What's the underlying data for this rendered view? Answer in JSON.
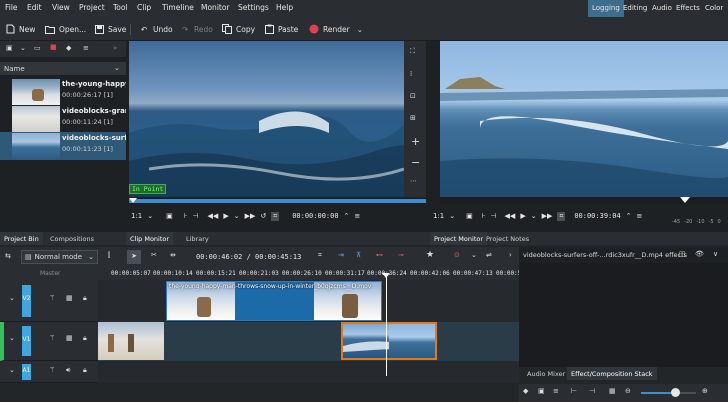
{
  "menu": [
    "File",
    "Edit",
    "View",
    "Project",
    "Tool",
    "Clip",
    "Timeline",
    "Monitor",
    "Settings",
    "Help"
  ],
  "layouts": [
    {
      "label": "Logging",
      "active": true
    },
    {
      "label": "Editing",
      "active": false
    },
    {
      "label": "Audio",
      "active": false
    },
    {
      "label": "Effects",
      "active": false
    },
    {
      "label": "Color",
      "active": false
    }
  ],
  "toolbar": {
    "new": "New",
    "open": "Open...",
    "save": "Save",
    "undo": "Undo",
    "redo": "Redo",
    "copy": "Copy",
    "paste": "Paste",
    "render": "Render"
  },
  "bin": {
    "column_header": "Name",
    "clips": [
      {
        "name": "the-young-happy-",
        "duration": "00:00:26:17 [1]",
        "selected": false
      },
      {
        "name": "videoblocks-grand",
        "duration": "00:00:11:24 [1]",
        "selected": false
      },
      {
        "name": "videoblocks-surfer",
        "duration": "00:00:11:23 [1]",
        "selected": true
      }
    ]
  },
  "left_tabs": [
    "Project Bin",
    "Compositions"
  ],
  "clip_monitor": {
    "overlay": "In Point",
    "zoom": "1:1",
    "timecode": "00:00:00:00",
    "tabs": [
      "Clip Monitor",
      "Library"
    ]
  },
  "project_monitor": {
    "zoom": "1:1",
    "timecode": "00:00:39:04",
    "tabs": [
      "Project Monitor",
      "Project Notes"
    ],
    "audio_scale": [
      "-45",
      "-20",
      "-10",
      "-5",
      "0"
    ]
  },
  "timeline": {
    "mode": "Normal mode",
    "position": "00:00:46:02 / 00:00:45:13",
    "ruler_label": "Master",
    "ruler_ticks": [
      "00:00:05:07",
      "00:00:10:14",
      "00:00:15:21",
      "00:00:21:03",
      "00:00:26:10",
      "00:00:31:17",
      "00:00:36:24",
      "00:00:42:06",
      "00:00:47:13",
      "00:00:52:20"
    ],
    "tracks": [
      {
        "name": "V2"
      },
      {
        "name": "V1"
      },
      {
        "name": "A1"
      }
    ],
    "clip_title": "the-young-happy-man-throws-snow-up-in-winter_b0qjzcms__D.mov"
  },
  "effects_panel": {
    "title": "videoblocks-surfers-off-...rdic3xufr__D.mp4 effects",
    "tabs": [
      "Audio Mixer",
      "Effect/Composition Stack"
    ]
  }
}
